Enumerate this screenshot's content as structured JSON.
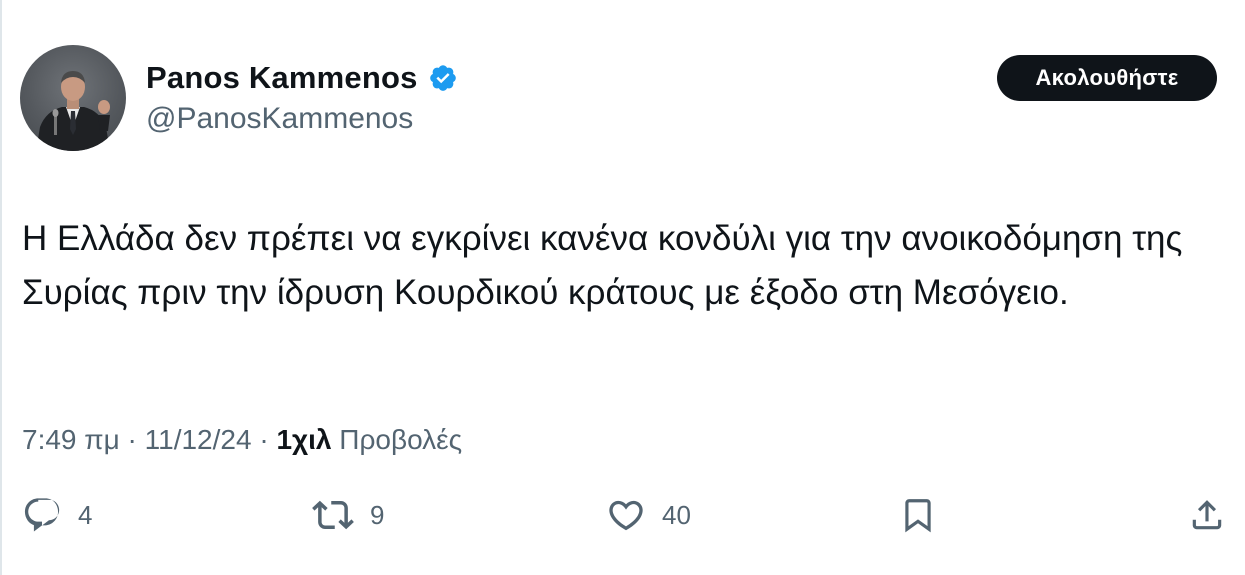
{
  "author": {
    "display_name": "Panos Kammenos",
    "handle": "@PanosKammenos",
    "verified": true,
    "verified_color": "#1d9bf0"
  },
  "follow_button": {
    "label": "Ακολουθήστε"
  },
  "tweet": {
    "text": "Η Ελλάδα δεν πρέπει να εγκρίνει κανένα κονδύλι για την ανοικοδόμηση της Συρίας πριν την ίδρυση Κουρδικού κράτους με έξοδο στη Μεσόγειο.",
    "time": "7:49 πμ",
    "separator": "·",
    "date": "11/12/24",
    "views_count": "1χιλ",
    "views_label": "Προβολές"
  },
  "actions": {
    "reply": {
      "icon": "reply-icon",
      "count": "4"
    },
    "repost": {
      "icon": "repost-icon",
      "count": "9"
    },
    "like": {
      "icon": "heart-icon",
      "count": "40"
    },
    "bookmark": {
      "icon": "bookmark-icon"
    },
    "share": {
      "icon": "share-icon"
    }
  },
  "colors": {
    "text": "#0f1419",
    "secondary": "#536471",
    "button_bg": "#0f1419",
    "button_text": "#ffffff"
  }
}
